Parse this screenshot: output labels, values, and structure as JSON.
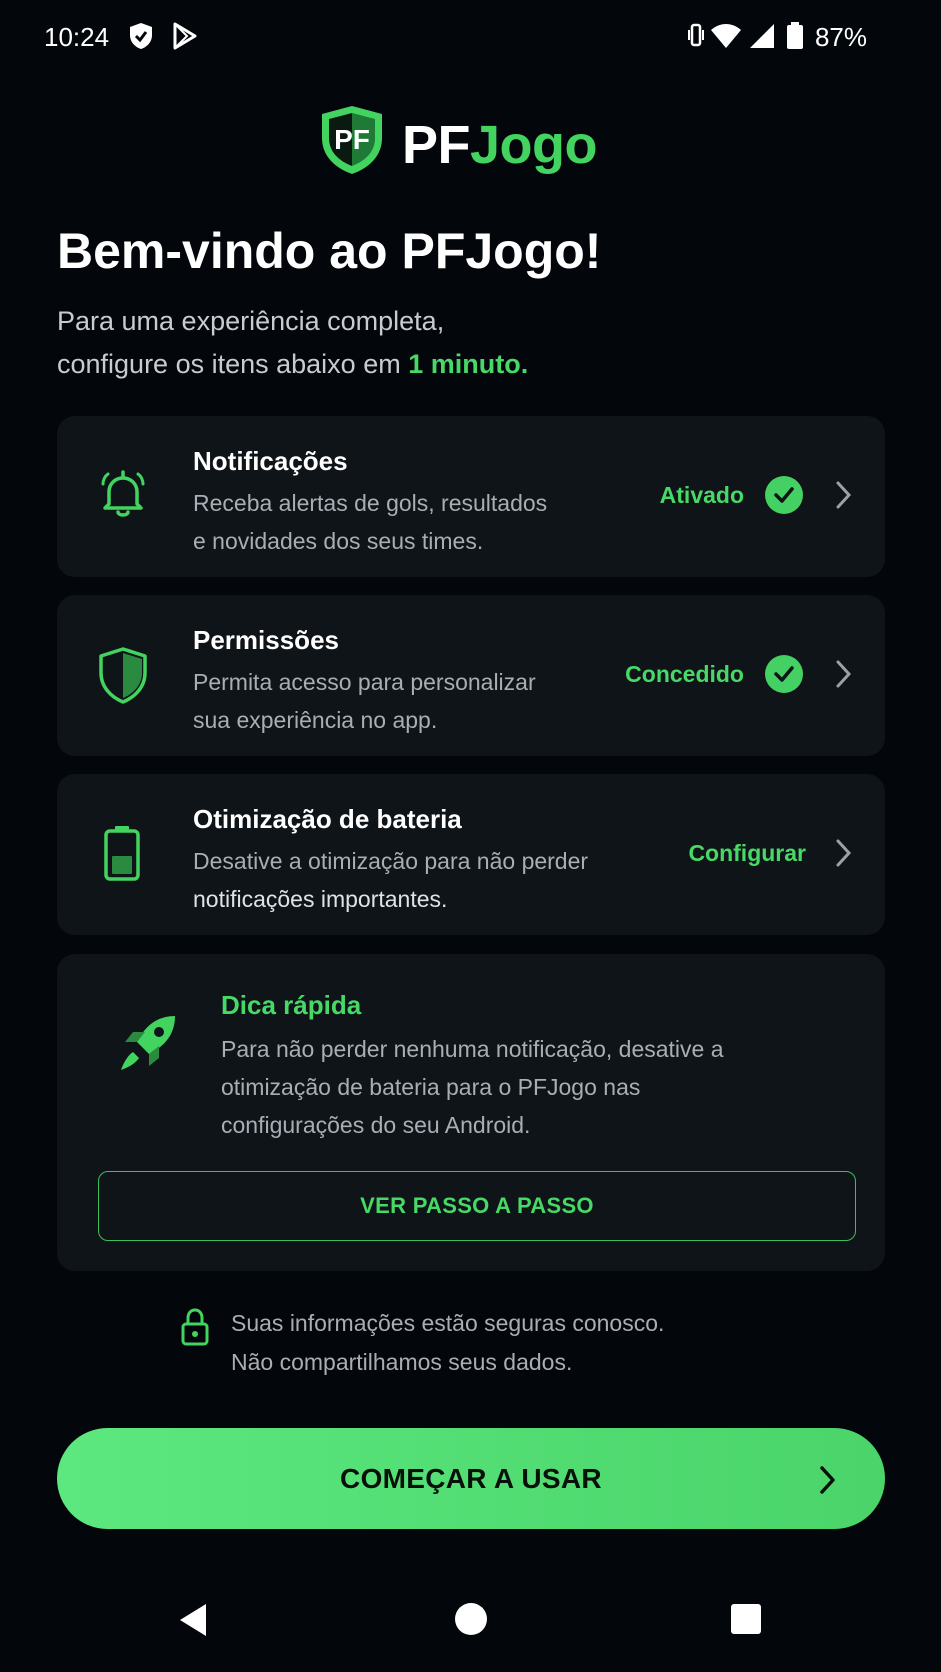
{
  "status_bar": {
    "time": "10:24",
    "battery": "87%"
  },
  "brand": {
    "shield_text": "PF",
    "name_part1": "PF",
    "name_part2": "Jogo",
    "accent": "#43d35f"
  },
  "welcome": {
    "title": "Bem-vindo ao PFJogo!",
    "subtitle_line1": "Para uma experiência completa,",
    "subtitle_line2_prefix": "configure os itens abaixo em ",
    "subtitle_line2_highlight": "1 minuto."
  },
  "settings": [
    {
      "icon": "bell-icon",
      "title": "Notificações",
      "desc1": "Receba alertas de gols, resultados",
      "desc2": "e novidades dos seus times.",
      "status": "Ativado",
      "checked": true
    },
    {
      "icon": "shield-icon",
      "title": "Permissões",
      "desc1": "Permita acesso para personalizar",
      "desc2": "sua experiência no app.",
      "status": "Concedido",
      "checked": true
    },
    {
      "icon": "battery-icon",
      "title": "Otimização de bateria",
      "desc1": "Desative a otimização para não perder",
      "desc2": "notificações importantes.",
      "status": "Configurar",
      "checked": false
    }
  ],
  "tip": {
    "icon": "rocket-icon",
    "title": "Dica rápida",
    "line1": "Para não perder nenhuma notificação, desative a",
    "line2": "otimização de bateria para o PFJogo nas",
    "line3": "configurações do seu Android.",
    "button": "VER PASSO A PASSO"
  },
  "security": {
    "line1": "Suas informações estão seguras conosco.",
    "line2": "Não compartilhamos seus dados."
  },
  "cta": {
    "label": "COMEÇAR A USAR"
  }
}
